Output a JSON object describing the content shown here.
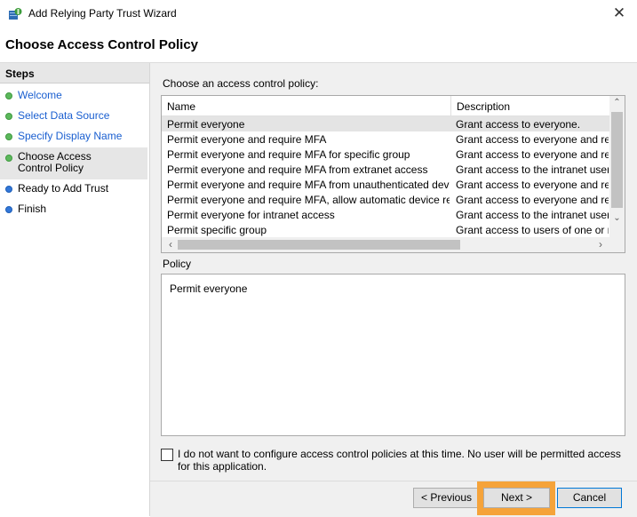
{
  "window": {
    "title": "Add Relying Party Trust Wizard",
    "close_glyph": "✕"
  },
  "header": {
    "title": "Choose Access Control Policy"
  },
  "sidebar": {
    "heading": "Steps",
    "items": [
      {
        "label": "Welcome",
        "status": "complete"
      },
      {
        "label": "Select Data Source",
        "status": "complete"
      },
      {
        "label": "Specify Display Name",
        "status": "complete"
      },
      {
        "label": "Choose Access Control Policy",
        "status": "current"
      },
      {
        "label": "Ready to Add Trust",
        "status": "pending"
      },
      {
        "label": "Finish",
        "status": "pending"
      }
    ]
  },
  "main": {
    "choose_label": "Choose an access control policy:",
    "table": {
      "columns": [
        "Name",
        "Description"
      ],
      "rows": [
        {
          "name": "Permit everyone",
          "description": "Grant access to everyone.",
          "selected": true
        },
        {
          "name": "Permit everyone and require MFA",
          "description": "Grant access to everyone and requir"
        },
        {
          "name": "Permit everyone and require MFA for specific group",
          "description": "Grant access to everyone and requir"
        },
        {
          "name": "Permit everyone and require MFA from extranet access",
          "description": "Grant access to the intranet users ar"
        },
        {
          "name": "Permit everyone and require MFA from unauthenticated devices",
          "description": "Grant access to everyone and requir"
        },
        {
          "name": "Permit everyone and require MFA, allow automatic device registr...",
          "description": "Grant access to everyone and requir"
        },
        {
          "name": "Permit everyone for intranet access",
          "description": "Grant access to the intranet users."
        },
        {
          "name": "Permit specific group",
          "description": "Grant access to users of one or more"
        }
      ]
    },
    "policy_label": "Policy",
    "policy_text": "Permit everyone",
    "optout_text": "I do not want to configure access control policies at this time.  No user will be permitted access for this application.",
    "optout_checked": false
  },
  "footer": {
    "previous_label": "< Previous",
    "next_label": "Next >",
    "cancel_label": "Cancel"
  },
  "colors": {
    "highlight": "#f5a33a",
    "link": "#1a5fd0",
    "step_complete": "#5cb85c",
    "step_pending": "#3277d8"
  }
}
